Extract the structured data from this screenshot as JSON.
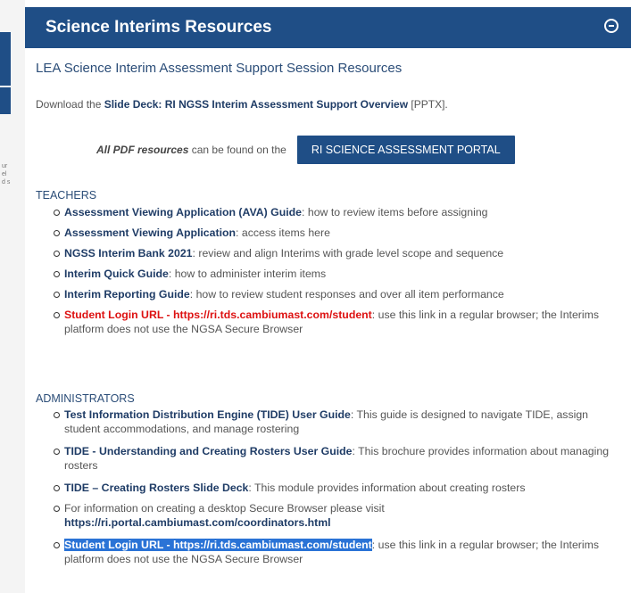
{
  "header": {
    "title": "Science Interims Resources"
  },
  "left_ghost": [
    "ur",
    "el",
    "d s"
  ],
  "subtitle": "LEA Science Interim Assessment Support Session Resources",
  "download": {
    "prefix": "Download the ",
    "link": "Slide Deck: RI NGSS Interim Assessment Support Overview",
    "suffix": " [PPTX]."
  },
  "portal": {
    "italic": "All PDF resources",
    "text": " can be found on the",
    "button": "RI SCIENCE ASSESSMENT PORTAL"
  },
  "teachers": {
    "title": "TEACHERS",
    "items": [
      {
        "link": "Assessment Viewing Application (AVA) Guide",
        "text": ": how to review items before assigning"
      },
      {
        "link": "Assessment Viewing Application",
        "text": ": access items here"
      },
      {
        "link": "NGSS Interim Bank 2021",
        "text": ": review and align Interims with grade level scope and sequence"
      },
      {
        "link": "Interim Quick Guide",
        "text": ": how to administer interim items"
      },
      {
        "link": "Interim Reporting Guide",
        "text": ": how to review student responses and over all item performance"
      },
      {
        "link": "Student Login URL - https://ri.tds.cambiumast.com/student",
        "text": ": use this link in a regular browser; the Interims platform does not use the NGSA Secure Browser"
      }
    ]
  },
  "administrators": {
    "title": "ADMINISTRATORS",
    "items": [
      {
        "link": "Test Information Distribution Engine (TIDE) User Guide",
        "text": ": This guide is designed to navigate TIDE, assign student accommodations, and manage rostering"
      },
      {
        "link": "TIDE - Understanding and Creating Rosters User Guide",
        "text": ": This brochure provides information about managing rosters"
      },
      {
        "link": "TIDE – Creating Rosters Slide Deck",
        "text": ": This module provides information about creating rosters"
      },
      {
        "text": "For information on creating a desktop Secure Browser please visit ",
        "link": "https://ri.portal.cambiumast.com/coordinators.html"
      },
      {
        "link": "Student Login URL - https://ri.tds.cambiumast.com/student",
        "text": ": use this link in a regular browser; the Interims platform does not use the NGSA Secure Browser"
      }
    ]
  }
}
